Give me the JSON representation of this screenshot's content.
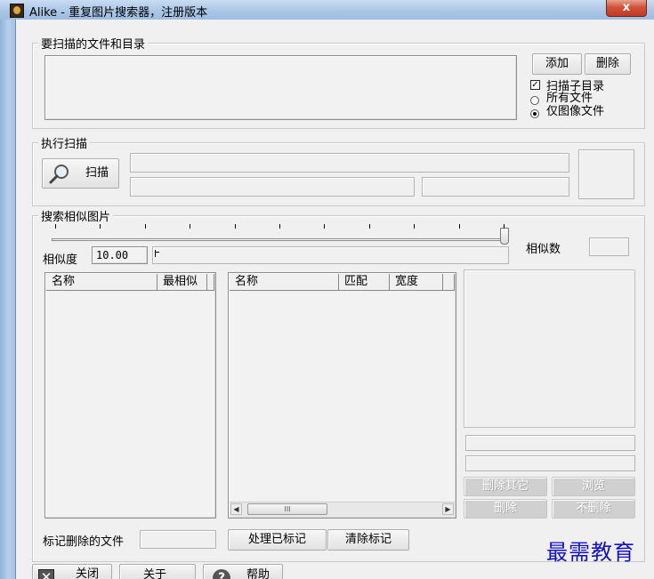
{
  "window": {
    "title": "Alike - 重复图片搜索器，注册版本",
    "close_glyph": "x",
    "icon": "mona-lisa-app-icon"
  },
  "scan_dirs": {
    "legend": "要扫描的文件和目录",
    "add_label": "添加",
    "delete_label": "删除",
    "subdir_label": "扫描子目录",
    "subdir_checked": true,
    "all_files_label": "所有文件",
    "images_only_label": "仅图像文件",
    "selected_filter": "仅图像文件"
  },
  "run_scan": {
    "legend": "执行扫描",
    "scan_label": "扫描",
    "scan_icon": "magnifier-icon"
  },
  "search": {
    "legend": "搜索相似图片",
    "similarity_label": "相似度",
    "similarity_value": "10.00",
    "similar_count_label": "相似数",
    "left_columns": [
      "名称",
      "最相似"
    ],
    "right_columns": [
      "名称",
      "匹配",
      "宽度"
    ],
    "scroll_grip": "III",
    "slider_ticks": 11
  },
  "preview": {
    "delete_others_label": "删除其它",
    "browse_label": "浏览",
    "delete_label": "删除",
    "no_delete_label": "不删除"
  },
  "footer": {
    "marked_label": "标记删除的文件",
    "process_marked_label": "处理已标记",
    "clear_marks_label": "清除标记"
  },
  "bottom_buttons": {
    "close_label": "关闭",
    "about_label": "关于",
    "help_label": "帮助"
  },
  "watermark": "最需教育"
}
